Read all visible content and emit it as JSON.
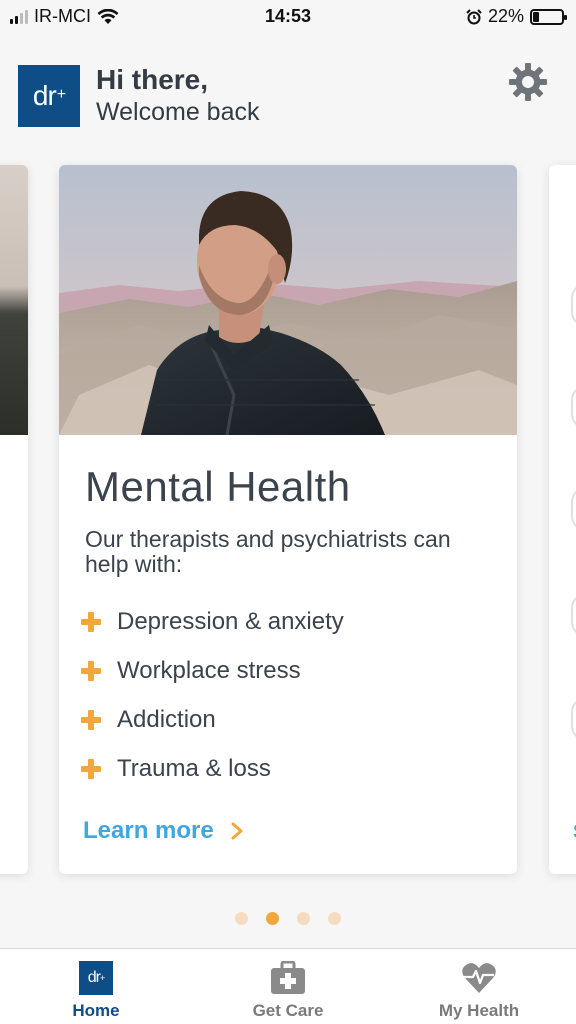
{
  "status_bar": {
    "carrier": "IR-MCI",
    "time": "14:53",
    "battery": "22%",
    "battery_level": 0.22,
    "icons": [
      "signal-icon",
      "wifi-icon",
      "alarm-icon",
      "battery-icon"
    ]
  },
  "header": {
    "logo_text": "dr",
    "logo_plus": "+",
    "greeting_title": "Hi there,",
    "greeting_sub": "Welcome back",
    "settings_icon": "gear-icon"
  },
  "card": {
    "title": "Mental Health",
    "subtitle": "Our therapists and psychiatrists can help with:",
    "items": [
      "Depression & anxiety",
      "Workplace stress",
      "Addiction",
      "Trauma & loss"
    ],
    "link_label": "Learn more"
  },
  "right_card": {
    "link_label": "S"
  },
  "pager": {
    "count": 4,
    "active_index": 1
  },
  "tabbar": {
    "tabs": [
      {
        "label": "Home",
        "icon": "dr-logo-icon",
        "active": true
      },
      {
        "label": "Get Care",
        "icon": "medical-kit-icon",
        "active": false
      },
      {
        "label": "My Health",
        "icon": "heart-pulse-icon",
        "active": false
      }
    ]
  },
  "colors": {
    "brand": "#0e4d86",
    "accent": "#efa83b",
    "link": "#3fa6df",
    "background": "#f6f6f6"
  }
}
